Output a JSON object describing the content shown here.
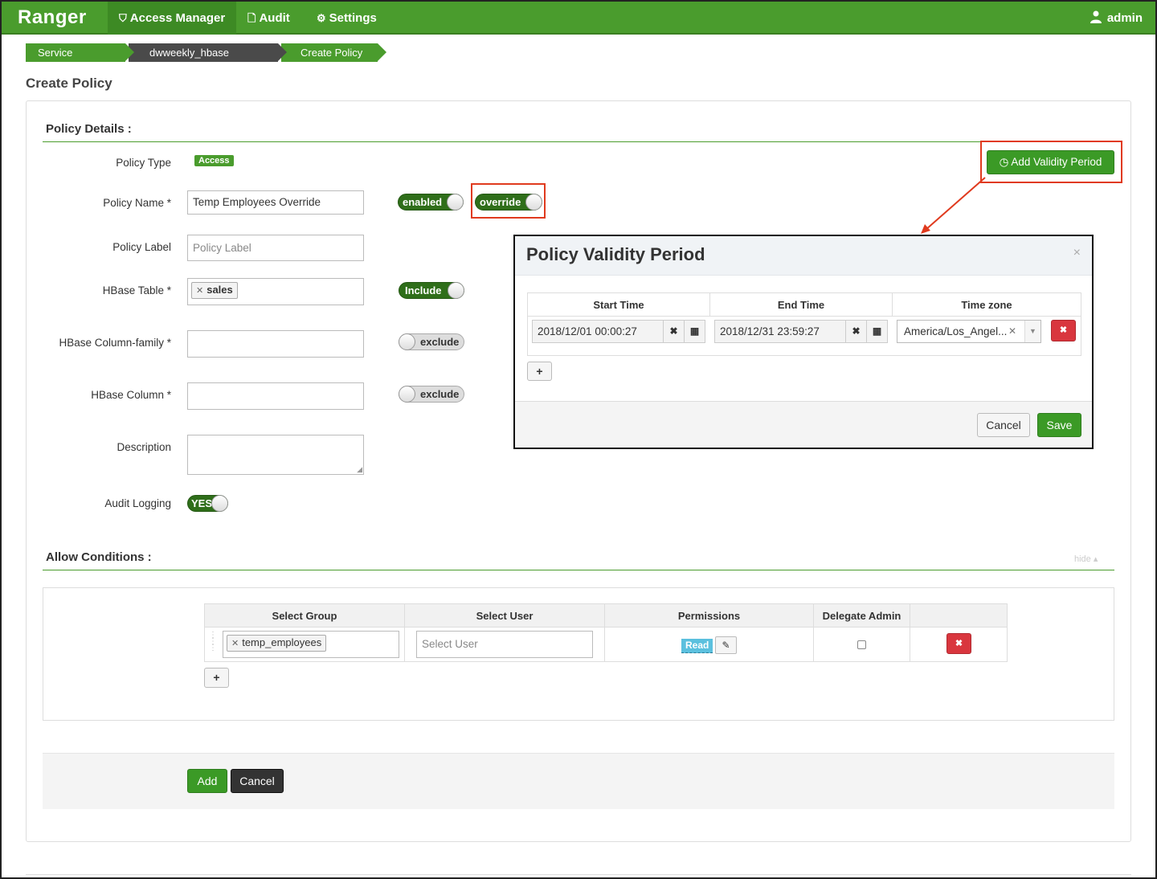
{
  "nav": {
    "brand": "Ranger",
    "items": [
      {
        "label": "Access Manager",
        "icon": "shield-icon"
      },
      {
        "label": "Audit",
        "icon": "file-icon"
      },
      {
        "label": "Settings",
        "icon": "gear-icon"
      }
    ],
    "user": "admin",
    "user_icon": "users-icon"
  },
  "breadcrumb": [
    "Service Manager",
    "dwweekly_hbase Policies",
    "Create Policy"
  ],
  "page_title": "Create Policy",
  "policy_details": {
    "heading": "Policy Details :",
    "policy_type_label": "Policy Type",
    "policy_type_value": "Access",
    "policy_name_label": "Policy Name *",
    "policy_name_value": "Temp Employees Override",
    "enabled_toggle": "enabled",
    "override_toggle": "override",
    "policy_label_label": "Policy Label",
    "policy_label_placeholder": "Policy Label",
    "hbase_table_label": "HBase Table *",
    "hbase_table_tag": "sales",
    "include_toggle": "Include",
    "column_family_label": "HBase Column-family *",
    "column_family_toggle": "exclude",
    "column_label": "HBase Column *",
    "column_toggle": "exclude",
    "description_label": "Description",
    "audit_label": "Audit Logging",
    "audit_toggle": "YES",
    "add_validity_button": "Add Validity Period"
  },
  "modal": {
    "title": "Policy Validity Period",
    "close": "×",
    "columns": [
      "Start Time",
      "End Time",
      "Time zone"
    ],
    "start_time": "2018/12/01 00:00:27",
    "end_time": "2018/12/31 23:59:27",
    "timezone": "America/Los_Angel...",
    "add_row": "+",
    "cancel": "Cancel",
    "save": "Save"
  },
  "allow_conditions": {
    "heading": "Allow Conditions :",
    "hide_link": "hide ▴",
    "columns": [
      "Select Group",
      "Select User",
      "Permissions",
      "Delegate Admin"
    ],
    "group_tag": "temp_employees",
    "user_placeholder": "Select User",
    "permission": "Read",
    "add_row": "+"
  },
  "footer": {
    "add": "Add",
    "cancel": "Cancel"
  },
  "colors": {
    "brand_green": "#4a9c2d",
    "highlight_red": "#e03a1e",
    "danger": "#d9363e",
    "info": "#5bc0de"
  }
}
